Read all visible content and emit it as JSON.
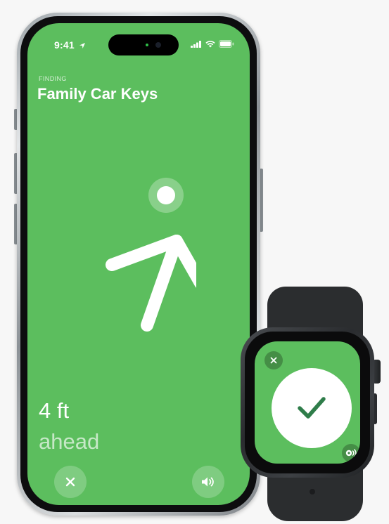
{
  "phone": {
    "status": {
      "time": "9:41"
    },
    "header": {
      "label": "FINDING",
      "title": "Family Car Keys"
    },
    "distance": {
      "value": "4 ft",
      "direction": "ahead"
    },
    "colors": {
      "screen": "#5cbe5e",
      "foreground": "#ffffff"
    },
    "icons": [
      "location-arrow-icon",
      "cellular-signal-icon",
      "wifi-icon",
      "battery-icon",
      "direction-arrow-icon",
      "close-icon",
      "speaker-icon"
    ]
  },
  "watch": {
    "state": "found",
    "colors": {
      "screen": "#5cbe5e",
      "checkmark": "#2f7d4a"
    },
    "icons": [
      "close-icon",
      "checkmark-icon",
      "play-sound-icon"
    ]
  }
}
